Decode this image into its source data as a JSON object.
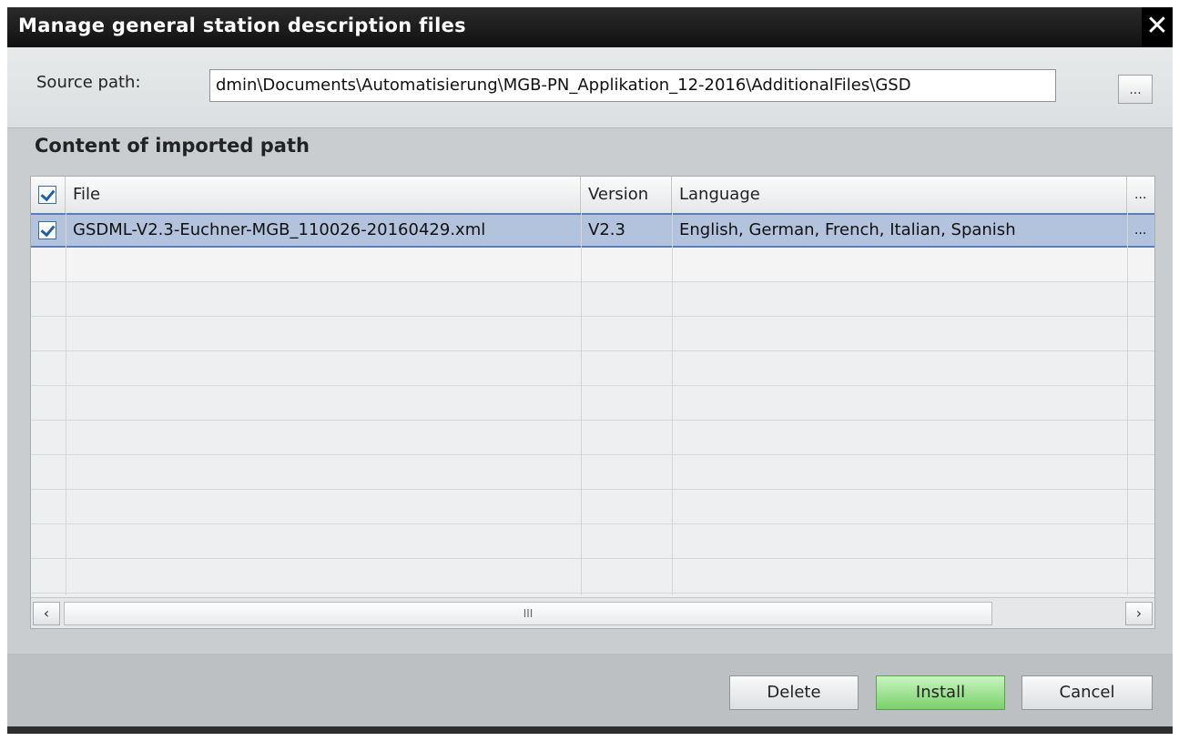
{
  "dialog": {
    "title": "Manage general station description files",
    "close_glyph": "✕"
  },
  "source": {
    "label": "Source path:",
    "value": "dmin\\Documents\\Automatisierung\\MGB-PN_Applikation_12-2016\\AdditionalFiles\\GSD",
    "browse_label": "..."
  },
  "content": {
    "title": "Content of imported path"
  },
  "table": {
    "columns": [
      "File",
      "Version",
      "Language",
      "..."
    ],
    "rows": [
      {
        "checked": true,
        "file": "GSDML-V2.3-Euchner-MGB_110026-20160429.xml",
        "version": "V2.3",
        "language": "English, German, French, Italian, Spanish",
        "more": "..."
      }
    ]
  },
  "scrollbar": {
    "left": "‹",
    "right": "›",
    "grip": "III"
  },
  "buttons": {
    "delete": "Delete",
    "install": "Install",
    "cancel": "Cancel"
  }
}
